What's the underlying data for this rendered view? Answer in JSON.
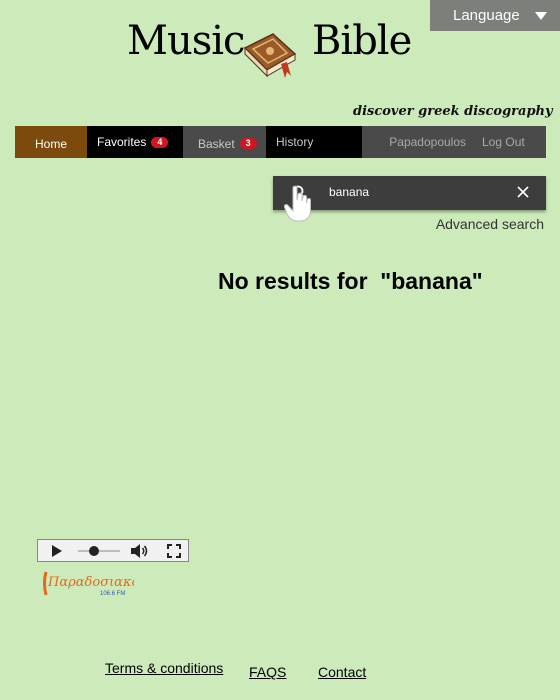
{
  "language": {
    "label": "Language"
  },
  "header": {
    "title_left": "Music",
    "title_right": "Bible",
    "tagline": "discover greek discography"
  },
  "nav": {
    "home": "Home",
    "favorites": "Favorites",
    "favorites_count": "4",
    "basket": "Basket",
    "basket_count": "3",
    "history": "History",
    "user": "Papadopoulos",
    "logout": "Log Out"
  },
  "search": {
    "query": "banana",
    "advanced": "Advanced search"
  },
  "results": {
    "message": "No results for  \"banana\""
  },
  "radio": {
    "logo_text": "Παραδοσιακός",
    "frequency": "106.6 FM"
  },
  "footer": {
    "terms": "Terms & conditions",
    "faqs": "FAQS",
    "contact": "Contact"
  },
  "colors": {
    "background": "#cdeabb",
    "home_active": "#7b4a0c",
    "badge": "#d3161d",
    "search_bg": "#3d3d3d"
  }
}
